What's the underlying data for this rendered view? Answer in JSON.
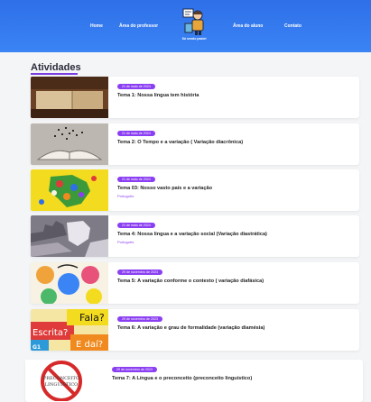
{
  "nav": {
    "home": "Home",
    "teacher_area": "Área do professor",
    "student_area": "Área do aluno",
    "contact": "Contato",
    "logo_caption": "Só sendo pastel"
  },
  "section_title": "Atividades",
  "cards": [
    {
      "date": "21 de maio de 2024",
      "title": "Tema 1: Nossa língua tem história",
      "tag": ""
    },
    {
      "date": "21 de maio de 2024",
      "title": "Tema 2: O Tempo e a variação ( Variação diacrônica)",
      "tag": ""
    },
    {
      "date": "21 de maio de 2024",
      "title": "Tema 03: Nosso vasto país e a variação",
      "tag": "Português"
    },
    {
      "date": "21 de maio de 2024",
      "title": "Tema 4: Nossa língua e a variação social (Variação diastrática)",
      "tag": "Português"
    },
    {
      "date": "29 de novembro de 2023",
      "title": "Tema 5: A variação conforme o contexto ( variação diafásica)",
      "tag": ""
    },
    {
      "date": "29 de novembro de 2023",
      "title": "Tema 6: A variação e grau de formalidade (variação diamésia)",
      "tag": ""
    },
    {
      "date": "29 de novembro de 2023",
      "title": "Tema 7: A Língua e o preconceito (preconceito linguístico)",
      "tag": ""
    }
  ],
  "thumb6": {
    "line1": "Fala?",
    "line2": "Escrita?",
    "line3": "E daí?",
    "corner": "G1"
  },
  "thumb7": {
    "line1": "PRECONCEITO",
    "line2": "LINGUÍSTICO"
  },
  "colors": {
    "header": "#3a7ef0",
    "accent": "#8b3ff2",
    "card_bg": "#ffffff",
    "page_bg": "#f4f5f7"
  }
}
